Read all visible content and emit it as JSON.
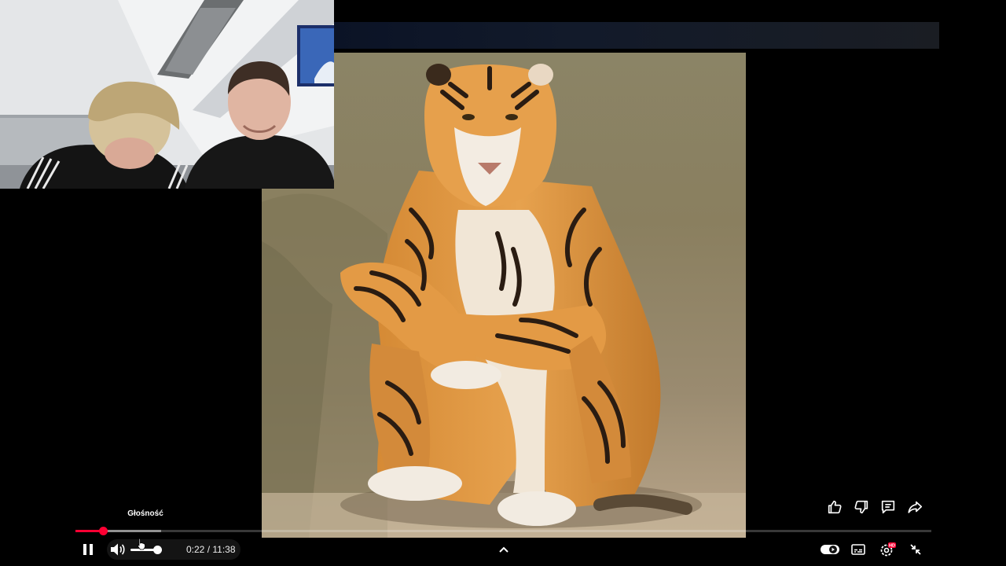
{
  "player": {
    "tooltip_text": "Głośność",
    "current_time": "0:22",
    "duration": "11:38",
    "time_separator": " / ",
    "progress_fraction": 0.032,
    "buffered_fraction": 0.1,
    "volume_fraction": 1.0
  },
  "controls": {
    "pause_icon": "pause-icon",
    "volume_icon": "volume-icon",
    "expand_icon": "chevron-up-icon",
    "autoplay_icon": "autoplay-toggle-icon",
    "subtitles_icon": "subtitles-icon",
    "settings_icon": "settings-gear-icon",
    "settings_badge": "HD",
    "exit_fullscreen_icon": "exit-fullscreen-icon"
  },
  "side_actions": [
    "like-icon",
    "dislike-icon",
    "comment-icon",
    "share-icon"
  ],
  "colors": {
    "progress": "#ff0033",
    "background": "#000000",
    "badge": "#ff0033"
  }
}
